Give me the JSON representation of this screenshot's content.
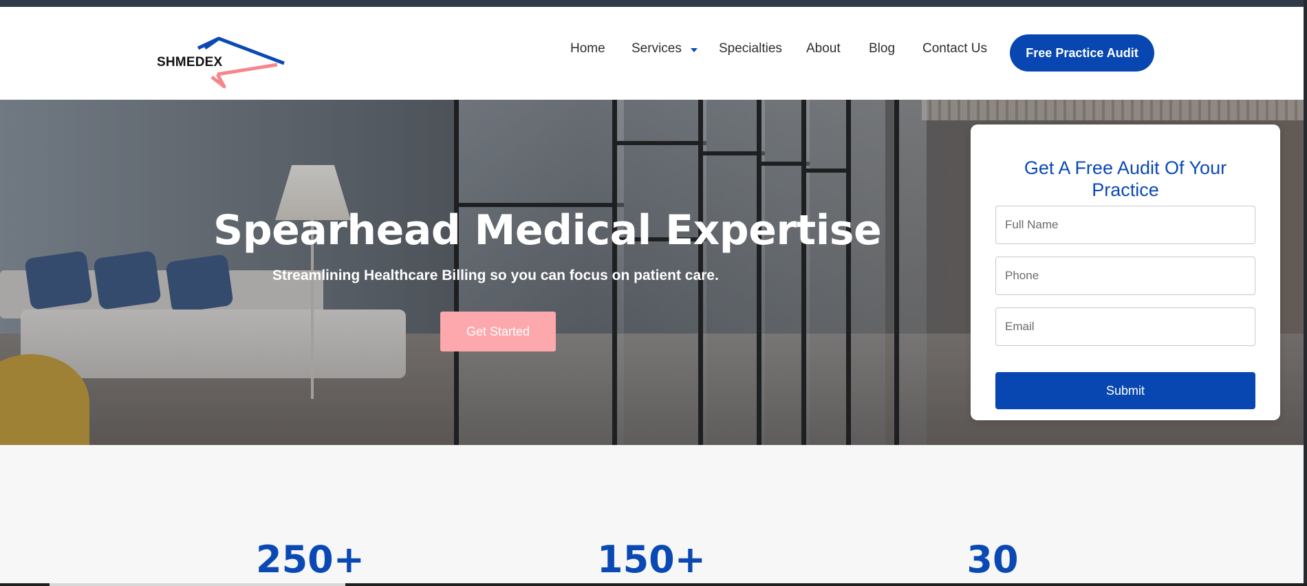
{
  "brand": {
    "name": "SHMEDEX",
    "colors": {
      "primary": "#0a49b4",
      "accent": "#fda8ac",
      "logo_blue": "#0a49b4",
      "logo_pink": "#f5868c"
    }
  },
  "nav": {
    "items": [
      {
        "label": "Home"
      },
      {
        "label": "Services",
        "has_dropdown": true
      },
      {
        "label": "Specialties"
      },
      {
        "label": "About"
      },
      {
        "label": "Blog"
      },
      {
        "label": "Contact Us"
      }
    ],
    "cta": "Free Practice Audit"
  },
  "hero": {
    "title": "Spearhead Medical Expertise",
    "subtitle": "Streamlining Healthcare Billing so you can focus on patient care.",
    "button": "Get Started"
  },
  "audit_form": {
    "title": "Get A Free Audit Of Your Practice",
    "fields": {
      "full_name": {
        "placeholder": "Full Name",
        "value": ""
      },
      "phone": {
        "placeholder": "Phone",
        "value": ""
      },
      "email": {
        "placeholder": "Email",
        "value": ""
      }
    },
    "submit": "Submit"
  },
  "stats": [
    {
      "value": "250+"
    },
    {
      "value": "150+"
    },
    {
      "value": "30"
    }
  ]
}
